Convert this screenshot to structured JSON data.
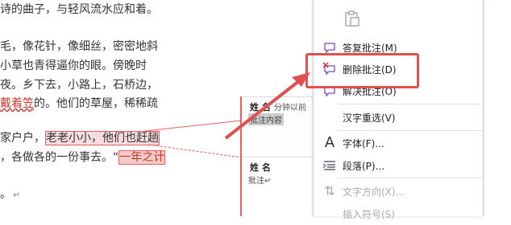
{
  "document": {
    "lines": [
      "诗的曲子，与轻风流水应和着。",
      "毛，像花针，像细丝，密密地斜",
      "小草也青得逼你的眼。傍晚时",
      "夜。乡下去，小路上，石桥边，",
      "戴着笠的。他们的草屋，稀稀疏"
    ],
    "line6_before": "家户户，",
    "line6_highlight": "老老小小，他们也赶趟",
    "line7_before": "，各做各的一份事去。“",
    "line7_highlight": "一年之计",
    "line9": "。",
    "line5_marked": "戴着笠",
    "line5_rest": "的。他们的草屋，稀稀疏",
    "paragraph_mark": "↵"
  },
  "comments": [
    {
      "author": "姓 名",
      "time": "分钟以前",
      "text": "批注内容"
    },
    {
      "author": "姓 名",
      "time": "",
      "text": "批注↵"
    }
  ],
  "context_menu": {
    "items": [
      {
        "label": "答复批注(M)",
        "icon": "reply-comment-icon",
        "enabled": true
      },
      {
        "label": "删除批注(D)",
        "icon": "delete-comment-icon",
        "enabled": true
      },
      {
        "label": "解决批注(O)",
        "icon": "resolve-comment-icon",
        "enabled": true
      },
      {
        "label": "汉字重选(V)",
        "icon": "",
        "enabled": true
      },
      {
        "label": "字体(F)...",
        "icon": "font-icon",
        "enabled": true
      },
      {
        "label": "段落(P)...",
        "icon": "paragraph-icon",
        "enabled": true
      },
      {
        "label": "文字方向(X)...",
        "icon": "text-direction-icon",
        "enabled": false
      },
      {
        "label": "插入符号(S)",
        "icon": "",
        "enabled": false
      }
    ]
  },
  "colors": {
    "accent": "#e05050",
    "highlight": "#f6dcdc"
  }
}
